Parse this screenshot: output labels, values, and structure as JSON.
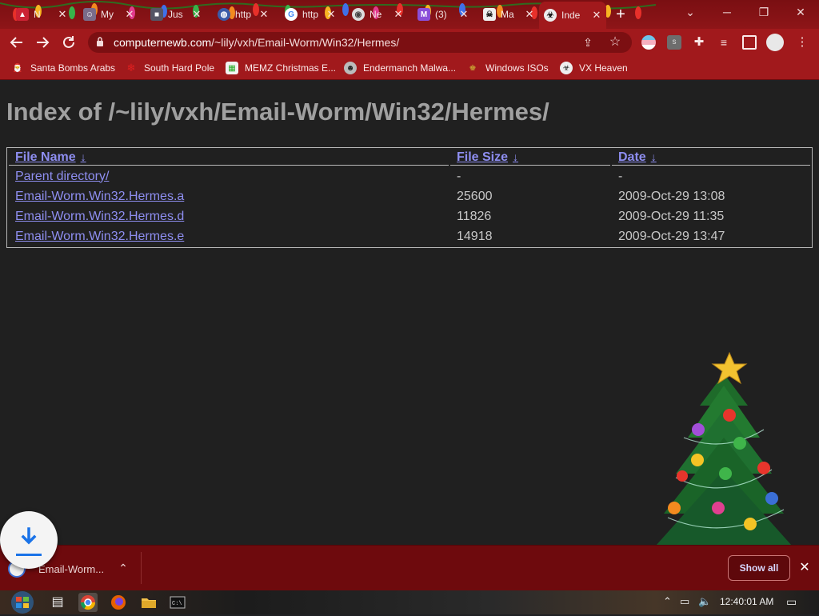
{
  "browser": {
    "tabs": [
      {
        "label": "N",
        "icon": "tab-favicon-red-icon"
      },
      {
        "label": "My",
        "icon": "tab-favicon-avatar-icon"
      },
      {
        "label": "Jus",
        "icon": "tab-favicon-photo-icon"
      },
      {
        "label": "http",
        "icon": "globe-icon"
      },
      {
        "label": "http",
        "icon": "google-icon"
      },
      {
        "label": "Ne",
        "icon": "chrome-icon"
      },
      {
        "label": "(3)",
        "icon": "mail-icon"
      },
      {
        "label": "Ma",
        "icon": "tab-favicon-skull-icon"
      },
      {
        "label": "Inde",
        "icon": "vx-heaven-icon",
        "active": true
      }
    ],
    "new_tab": "+",
    "window_controls": {
      "minimize": "─",
      "restore": "❐",
      "close": "✕",
      "tab_search": "⌄"
    },
    "address": {
      "host": "computernewb.com",
      "path": "/~lily/vxh/Email-Worm/Win32/Hermes/"
    },
    "bookmarks": [
      {
        "label": "Santa Bombs Arabs"
      },
      {
        "label": "South Hard Pole"
      },
      {
        "label": "MEMZ Christmas E..."
      },
      {
        "label": "Endermanch Malwa..."
      },
      {
        "label": "Windows ISOs"
      },
      {
        "label": "VX Heaven"
      }
    ]
  },
  "page": {
    "title": "Index of /~lily/vxh/Email-Worm/Win32/Hermes/",
    "columns": {
      "name": "File Name",
      "size": "File Size",
      "date": "Date",
      "sort_arrow": "↓"
    },
    "rows": [
      {
        "name": "Parent directory/",
        "size": "-",
        "date": "-"
      },
      {
        "name": "Email-Worm.Win32.Hermes.a",
        "size": "25600",
        "date": "2009-Oct-29 13:08"
      },
      {
        "name": "Email-Worm.Win32.Hermes.d",
        "size": "11826",
        "date": "2009-Oct-29 11:35"
      },
      {
        "name": "Email-Worm.Win32.Hermes.e",
        "size": "14918",
        "date": "2009-Oct-29 13:47"
      }
    ]
  },
  "downloads": {
    "item": "Email-Worm...",
    "show_all": "Show all",
    "close": "✕",
    "caret": "⌃"
  },
  "taskbar": {
    "clock": "12:40:01 AM",
    "caret": "⌃"
  },
  "colors": {
    "theme_red": "#a1191c",
    "link": "#8e8ef0",
    "heading": "#a0a0a0",
    "page_bg": "#202020"
  }
}
